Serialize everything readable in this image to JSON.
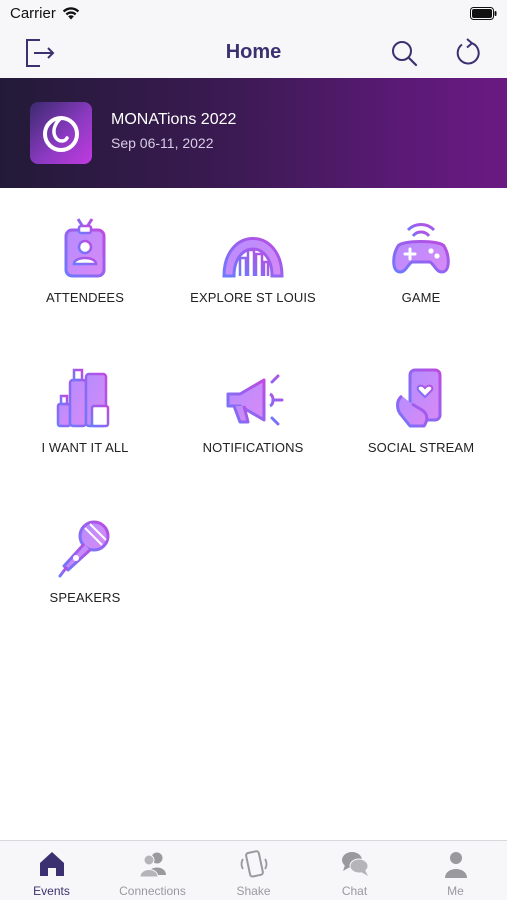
{
  "status_bar": {
    "carrier": "Carrier"
  },
  "nav": {
    "title": "Home",
    "left_icon": "logout-icon",
    "right_icons": [
      "search-icon",
      "refresh-icon"
    ]
  },
  "event": {
    "name": "MONATions 2022",
    "dates": "Sep 06-11, 2022"
  },
  "tiles": [
    {
      "label": "ATTENDEES",
      "icon": "badge-icon"
    },
    {
      "label": "EXPLORE ST LOUIS",
      "icon": "arch-icon"
    },
    {
      "label": "GAME",
      "icon": "gamepad-icon"
    },
    {
      "label": "I WANT IT ALL",
      "icon": "products-icon"
    },
    {
      "label": "NOTIFICATIONS",
      "icon": "megaphone-icon"
    },
    {
      "label": "SOCIAL STREAM",
      "icon": "phone-heart-icon"
    },
    {
      "label": "SPEAKERS",
      "icon": "microphone-icon"
    }
  ],
  "tabs": [
    {
      "label": "Events",
      "icon": "home-icon",
      "active": true
    },
    {
      "label": "Connections",
      "icon": "people-icon",
      "active": false
    },
    {
      "label": "Shake",
      "icon": "shake-phone-icon",
      "active": false
    },
    {
      "label": "Chat",
      "icon": "chat-bubbles-icon",
      "active": false
    },
    {
      "label": "Me",
      "icon": "person-icon",
      "active": false
    }
  ],
  "colors": {
    "accent": "#3b3170",
    "icon_gradient_start": "#6b7bff",
    "icon_gradient_end": "#c04ae0",
    "tab_inactive": "#9a9a9e"
  }
}
